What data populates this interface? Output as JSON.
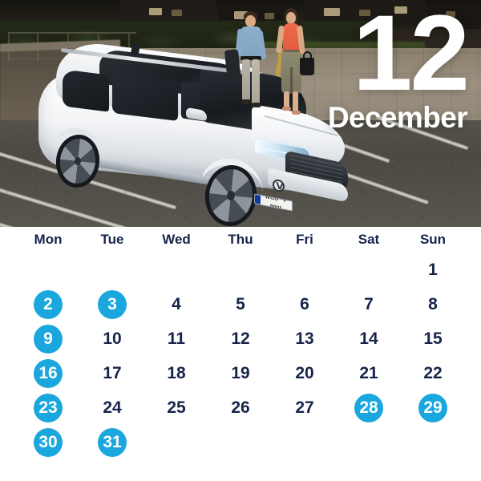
{
  "hero": {
    "date_number": "12",
    "month_label": "December",
    "vehicle_plate": "WOB · P 9001",
    "scene_description": "White Volkswagen estate parked in a marked parking bay at dusk with a couple walking hand in hand"
  },
  "calendar": {
    "weekday_headers": [
      "Mon",
      "Tue",
      "Wed",
      "Thu",
      "Fri",
      "Sat",
      "Sun"
    ],
    "weeks": [
      [
        {
          "label": "",
          "highlight": false,
          "empty": true
        },
        {
          "label": "",
          "highlight": false,
          "empty": true
        },
        {
          "label": "",
          "highlight": false,
          "empty": true
        },
        {
          "label": "",
          "highlight": false,
          "empty": true
        },
        {
          "label": "",
          "highlight": false,
          "empty": true
        },
        {
          "label": "",
          "highlight": false,
          "empty": true
        },
        {
          "label": "1",
          "highlight": false,
          "empty": false
        }
      ],
      [
        {
          "label": "2",
          "highlight": true,
          "empty": false
        },
        {
          "label": "3",
          "highlight": true,
          "empty": false
        },
        {
          "label": "4",
          "highlight": false,
          "empty": false
        },
        {
          "label": "5",
          "highlight": false,
          "empty": false
        },
        {
          "label": "6",
          "highlight": false,
          "empty": false
        },
        {
          "label": "7",
          "highlight": false,
          "empty": false
        },
        {
          "label": "8",
          "highlight": false,
          "empty": false
        }
      ],
      [
        {
          "label": "9",
          "highlight": true,
          "empty": false
        },
        {
          "label": "10",
          "highlight": false,
          "empty": false
        },
        {
          "label": "11",
          "highlight": false,
          "empty": false
        },
        {
          "label": "12",
          "highlight": false,
          "empty": false
        },
        {
          "label": "13",
          "highlight": false,
          "empty": false
        },
        {
          "label": "14",
          "highlight": false,
          "empty": false
        },
        {
          "label": "15",
          "highlight": false,
          "empty": false
        }
      ],
      [
        {
          "label": "16",
          "highlight": true,
          "empty": false
        },
        {
          "label": "17",
          "highlight": false,
          "empty": false
        },
        {
          "label": "18",
          "highlight": false,
          "empty": false
        },
        {
          "label": "19",
          "highlight": false,
          "empty": false
        },
        {
          "label": "20",
          "highlight": false,
          "empty": false
        },
        {
          "label": "21",
          "highlight": false,
          "empty": false
        },
        {
          "label": "22",
          "highlight": false,
          "empty": false
        }
      ],
      [
        {
          "label": "23",
          "highlight": true,
          "empty": false
        },
        {
          "label": "24",
          "highlight": false,
          "empty": false
        },
        {
          "label": "25",
          "highlight": false,
          "empty": false
        },
        {
          "label": "26",
          "highlight": false,
          "empty": false
        },
        {
          "label": "27",
          "highlight": false,
          "empty": false
        },
        {
          "label": "28",
          "highlight": true,
          "empty": false
        },
        {
          "label": "29",
          "highlight": true,
          "empty": false
        }
      ],
      [
        {
          "label": "30",
          "highlight": true,
          "empty": false
        },
        {
          "label": "31",
          "highlight": true,
          "empty": false
        },
        {
          "label": "",
          "highlight": false,
          "empty": true
        },
        {
          "label": "",
          "highlight": false,
          "empty": true
        },
        {
          "label": "",
          "highlight": false,
          "empty": true
        },
        {
          "label": "",
          "highlight": false,
          "empty": true
        },
        {
          "label": "",
          "highlight": false,
          "empty": true
        }
      ]
    ]
  },
  "colors": {
    "highlight_blue": "#1aa7dd",
    "text_navy": "#17244a",
    "overlay_text": "#ffffff",
    "background": "#ffffff"
  }
}
